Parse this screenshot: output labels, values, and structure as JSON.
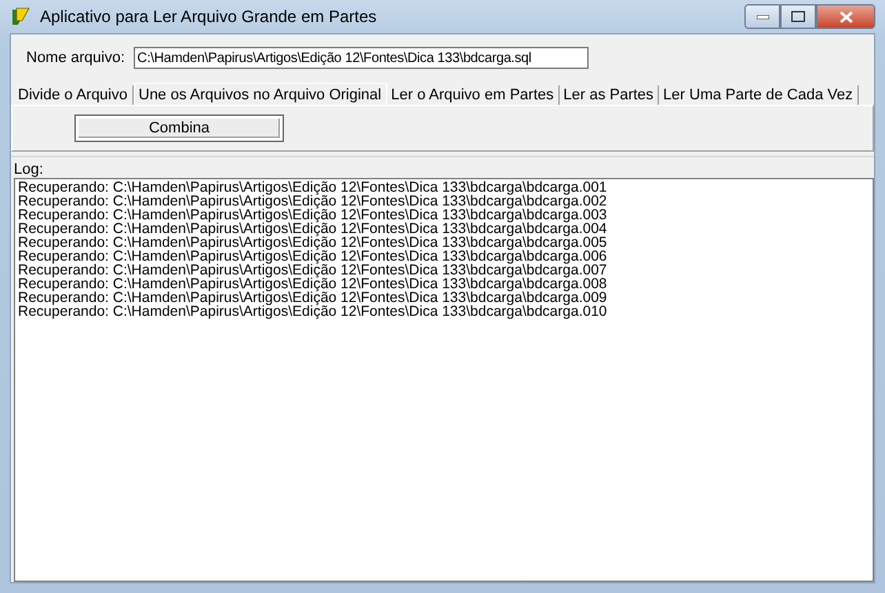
{
  "window": {
    "title": "Aplicativo para Ler Arquivo Grande em Partes"
  },
  "file_field": {
    "label": "Nome arquivo:",
    "value": "C:\\Hamden\\Papirus\\Artigos\\Edição 12\\Fontes\\Dica 133\\bdcarga.sql"
  },
  "tabs": [
    {
      "label": "Divide o Arquivo",
      "selected": false
    },
    {
      "label": "Une os Arquivos no Arquivo Original",
      "selected": true
    },
    {
      "label": "Ler o Arquivo em Partes",
      "selected": false
    },
    {
      "label": "Ler as Partes",
      "selected": false
    },
    {
      "label": "Ler Uma Parte de Cada Vez",
      "selected": false
    }
  ],
  "combine_button": "Combina",
  "log": {
    "label": "Log:",
    "lines": [
      "Recuperando: C:\\Hamden\\Papirus\\Artigos\\Edição 12\\Fontes\\Dica 133\\bdcarga\\bdcarga.001",
      "Recuperando: C:\\Hamden\\Papirus\\Artigos\\Edição 12\\Fontes\\Dica 133\\bdcarga\\bdcarga.002",
      "Recuperando: C:\\Hamden\\Papirus\\Artigos\\Edição 12\\Fontes\\Dica 133\\bdcarga\\bdcarga.003",
      "Recuperando: C:\\Hamden\\Papirus\\Artigos\\Edição 12\\Fontes\\Dica 133\\bdcarga\\bdcarga.004",
      "Recuperando: C:\\Hamden\\Papirus\\Artigos\\Edição 12\\Fontes\\Dica 133\\bdcarga\\bdcarga.005",
      "Recuperando: C:\\Hamden\\Papirus\\Artigos\\Edição 12\\Fontes\\Dica 133\\bdcarga\\bdcarga.006",
      "Recuperando: C:\\Hamden\\Papirus\\Artigos\\Edição 12\\Fontes\\Dica 133\\bdcarga\\bdcarga.007",
      "Recuperando: C:\\Hamden\\Papirus\\Artigos\\Edição 12\\Fontes\\Dica 133\\bdcarga\\bdcarga.008",
      "Recuperando: C:\\Hamden\\Papirus\\Artigos\\Edição 12\\Fontes\\Dica 133\\bdcarga\\bdcarga.009",
      "Recuperando: C:\\Hamden\\Papirus\\Artigos\\Edição 12\\Fontes\\Dica 133\\bdcarga\\bdcarga.010"
    ]
  }
}
